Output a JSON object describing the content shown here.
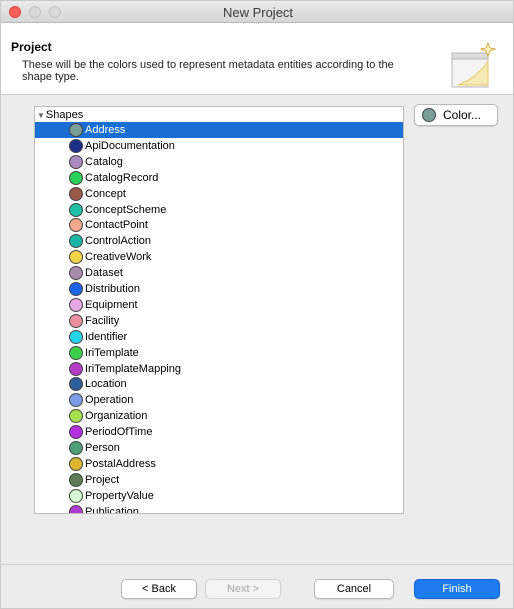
{
  "window": {
    "title": "New Project"
  },
  "banner": {
    "title": "Project",
    "description": "These will be the colors used to represent metadata entities according to the shape type."
  },
  "tree": {
    "root_label": "Shapes",
    "items": [
      {
        "label": "Address",
        "color": "#7a9e9a",
        "selected": true
      },
      {
        "label": "ApiDocumentation",
        "color": "#1a2e8a"
      },
      {
        "label": "Catalog",
        "color": "#a98bbf"
      },
      {
        "label": "CatalogRecord",
        "color": "#29d05a"
      },
      {
        "label": "Concept",
        "color": "#9a5a4a"
      },
      {
        "label": "ConceptScheme",
        "color": "#20bfa6"
      },
      {
        "label": "ContactPoint",
        "color": "#f3a78c"
      },
      {
        "label": "ControlAction",
        "color": "#1bb3a3"
      },
      {
        "label": "CreativeWork",
        "color": "#f2d34a"
      },
      {
        "label": "Dataset",
        "color": "#a98bab"
      },
      {
        "label": "Distribution",
        "color": "#1c65e8"
      },
      {
        "label": "Equipment",
        "color": "#e6a6e4"
      },
      {
        "label": "Facility",
        "color": "#e88f9f"
      },
      {
        "label": "Identifier",
        "color": "#22d4ea"
      },
      {
        "label": "IriTemplate",
        "color": "#3ccf4a"
      },
      {
        "label": "IriTemplateMapping",
        "color": "#b43cc4"
      },
      {
        "label": "Location",
        "color": "#2a5f9a"
      },
      {
        "label": "Operation",
        "color": "#7d9be6"
      },
      {
        "label": "Organization",
        "color": "#a7df4f"
      },
      {
        "label": "PeriodOfTime",
        "color": "#b42fe0"
      },
      {
        "label": "Person",
        "color": "#4aa07a"
      },
      {
        "label": "PostalAddress",
        "color": "#dcb531"
      },
      {
        "label": "Project",
        "color": "#5f7a57"
      },
      {
        "label": "PropertyValue",
        "color": "#d8f6d6"
      },
      {
        "label": "Publication",
        "color": "#b03ad6"
      }
    ]
  },
  "color_button": {
    "label": "Color...",
    "swatch": "#7a9e9a"
  },
  "buttons": {
    "back": "< Back",
    "next": "Next >",
    "cancel": "Cancel",
    "finish": "Finish"
  }
}
